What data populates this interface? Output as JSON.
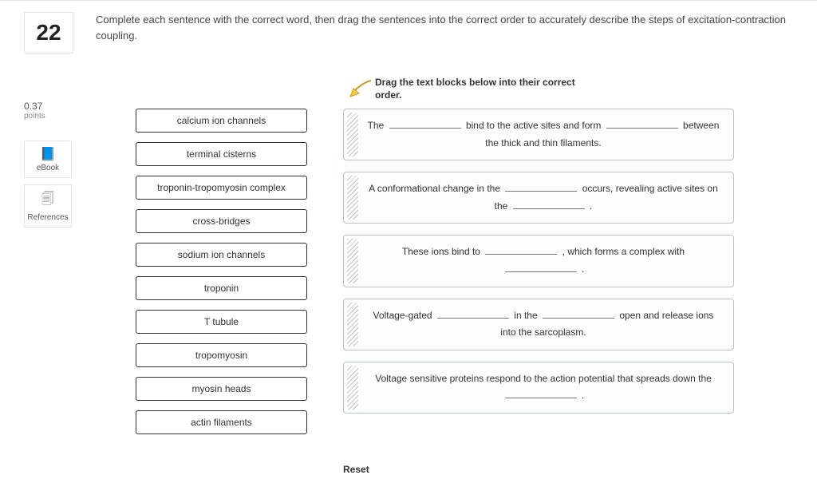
{
  "question_number": "22",
  "prompt": "Complete each sentence with the correct word, then drag the sentences into the correct order to accurately describe the steps of excitation-contraction coupling.",
  "points_value": "0.37",
  "points_label": "points",
  "ebook_label": "eBook",
  "references_label": "References",
  "drag_instruction": "Drag the text blocks below into their correct order.",
  "reset_label": "Reset",
  "word_bank": [
    "calcium ion channels",
    "terminal cisterns",
    "troponin-tropomyosin complex",
    "cross-bridges",
    "sodium ion channels",
    "troponin",
    "T tubule",
    "tropomyosin",
    "myosin heads",
    "actin filaments"
  ],
  "sentences": {
    "s1a": "The ",
    "s1b": " bind to the active sites and form ",
    "s1c": " between the thick and thin filaments.",
    "s2a": "A conformational change in the ",
    "s2b": " occurs, revealing active sites on the ",
    "s2c": " .",
    "s3a": "These ions bind to ",
    "s3b": " , which forms a complex with ",
    "s3c": " .",
    "s4a": "Voltage-gated ",
    "s4b": " in the ",
    "s4c": " open and release ions into the sarcoplasm.",
    "s5a": "Voltage sensitive proteins respond to the action potential that spreads down the ",
    "s5b": " ."
  }
}
